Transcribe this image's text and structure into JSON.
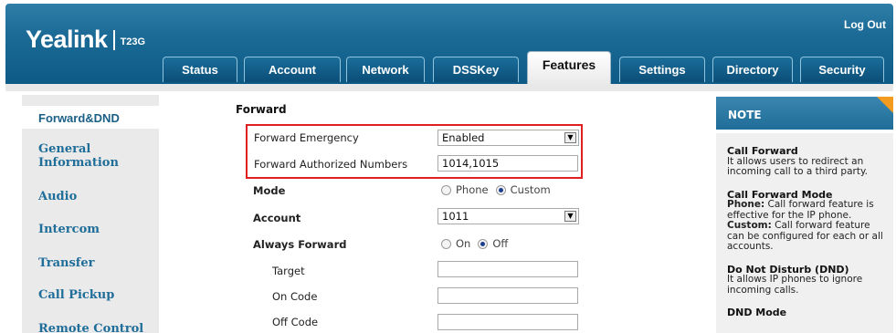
{
  "brand": {
    "name": "Yealink",
    "model": "T23G"
  },
  "header": {
    "logout": "Log Out"
  },
  "tabs": [
    {
      "label": "Status"
    },
    {
      "label": "Account"
    },
    {
      "label": "Network"
    },
    {
      "label": "DSSKey"
    },
    {
      "label": "Features",
      "active": true
    },
    {
      "label": "Settings"
    },
    {
      "label": "Directory"
    },
    {
      "label": "Security"
    }
  ],
  "sidebar": {
    "items": [
      {
        "label": "Forward&DND",
        "active": true
      },
      {
        "label": "General Information"
      },
      {
        "label": "Audio"
      },
      {
        "label": "Intercom"
      },
      {
        "label": "Transfer"
      },
      {
        "label": "Call Pickup"
      },
      {
        "label": "Remote Control"
      }
    ]
  },
  "main": {
    "section_title": "Forward",
    "forward_emergency": {
      "label": "Forward Emergency",
      "value": "Enabled"
    },
    "forward_numbers": {
      "label": "Forward Authorized Numbers",
      "value": "1014,1015"
    },
    "mode": {
      "label": "Mode",
      "options": [
        "Phone",
        "Custom"
      ],
      "selected": "Custom"
    },
    "account": {
      "label": "Account",
      "value": "1011"
    },
    "always_forward": {
      "label": "Always Forward",
      "options": [
        "On",
        "Off"
      ],
      "selected": "Off"
    },
    "target": {
      "label": "Target",
      "value": ""
    },
    "on_code": {
      "label": "On Code",
      "value": ""
    },
    "off_code": {
      "label": "Off Code",
      "value": ""
    }
  },
  "note": {
    "title": "NOTE",
    "blocks": [
      {
        "title": "Call Forward",
        "text": "It allows users to redirect an incoming call to a third party."
      },
      {
        "title": "Call Forward Mode",
        "phone_label": "Phone:",
        "phone_text": "Call forward feature is effective for the IP phone.",
        "custom_label": "Custom:",
        "custom_text": "Call forward feature can be configured for each or all accounts."
      },
      {
        "title": "Do Not Disturb (DND)",
        "text": "It allows IP phones to ignore incoming calls."
      },
      {
        "title": "DND Mode"
      }
    ]
  },
  "colors": {
    "header_blue": "#1b6a96",
    "accent_orange": "#f39b1e",
    "highlight_red": "#e02020",
    "link_blue": "#1f6d99"
  }
}
